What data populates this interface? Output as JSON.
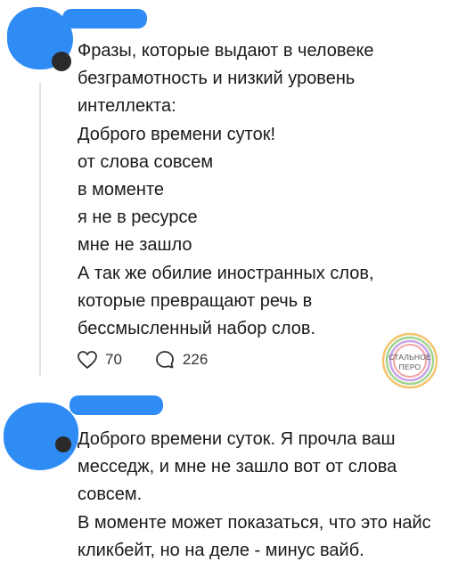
{
  "posts": [
    {
      "text": "Фразы, которые выдают в человеке безграмотность и низкий уровень интеллекта:\nДоброго времени суток!\nот слова совсем\nв моменте\nя не в ресурсе\nмне не зашло\nА так же обилие иностранных слов, которые превращают речь в бессмысленный набор слов.",
      "likes": "70",
      "replies": "226"
    },
    {
      "text": "Доброго времени суток. Я прочла ваш месседж, и мне не зашло вот от слова совсем.\nВ моменте может показаться, что это найс кликбейт, но на деле - минус вайб."
    }
  ],
  "watermark": {
    "line1": "СТАЛЬНОЕ",
    "line2": "ПЕРО"
  },
  "colors": {
    "redaction": "#2f8cf4",
    "text": "#1a1a1a",
    "thread_line": "#e3e3e3"
  }
}
